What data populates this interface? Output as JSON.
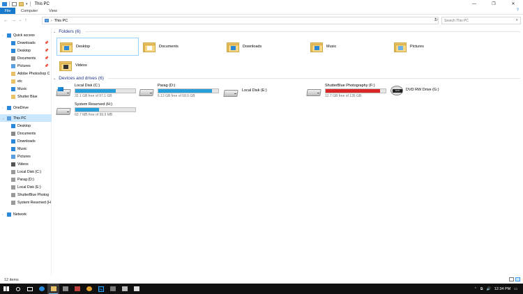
{
  "window": {
    "title": "This PC",
    "buttons": [
      "—",
      "❐",
      "✕"
    ]
  },
  "ribbon": {
    "tabs": [
      "File",
      "Computer",
      "View"
    ],
    "help": "?"
  },
  "nav": {
    "back": "←",
    "forward": "→",
    "recent": "⌄",
    "up": "↑"
  },
  "address": {
    "separator": "›",
    "crumb": "This PC",
    "refresh": "↻"
  },
  "search": {
    "placeholder": "Search This PC",
    "icon_glyph": "⌕"
  },
  "sidebar": {
    "items": [
      {
        "label": "Quick access",
        "icon": "star-icon",
        "color": "#2b88d8",
        "pinned": false,
        "selected": false
      },
      {
        "label": "Downloads",
        "icon": "download-icon",
        "color": "#2b88d8",
        "pinned": true,
        "selected": false
      },
      {
        "label": "Desktop",
        "icon": "desktop-icon",
        "color": "#2b88d8",
        "pinned": true,
        "selected": false
      },
      {
        "label": "Documents",
        "icon": "documents-icon",
        "color": "#8a8a8a",
        "pinned": true,
        "selected": false
      },
      {
        "label": "Pictures",
        "icon": "pictures-icon",
        "color": "#5aa0e0",
        "pinned": true,
        "selected": false
      },
      {
        "label": "Adobe Photoshop C",
        "icon": "folder-icon",
        "color": "#e8c169",
        "pinned": false,
        "selected": false
      },
      {
        "label": "etc",
        "icon": "folder-icon",
        "color": "#e8c169",
        "pinned": false,
        "selected": false
      },
      {
        "label": "Music",
        "icon": "music-icon",
        "color": "#2b88d8",
        "pinned": false,
        "selected": false
      },
      {
        "label": "Shutter Blue",
        "icon": "folder-icon",
        "color": "#e8c169",
        "pinned": false,
        "selected": false
      },
      {
        "label": "OneDrive",
        "icon": "cloud-icon",
        "color": "#2b88d8",
        "pinned": false,
        "selected": false
      },
      {
        "label": "This PC",
        "icon": "computer-icon",
        "color": "#5aa0e0",
        "pinned": false,
        "selected": true
      },
      {
        "label": "Desktop",
        "icon": "desktop-icon",
        "color": "#2b88d8",
        "pinned": false,
        "selected": false
      },
      {
        "label": "Documents",
        "icon": "documents-icon",
        "color": "#8a8a8a",
        "pinned": false,
        "selected": false
      },
      {
        "label": "Downloads",
        "icon": "download-icon",
        "color": "#2b88d8",
        "pinned": false,
        "selected": false
      },
      {
        "label": "Music",
        "icon": "music-icon",
        "color": "#2b88d8",
        "pinned": false,
        "selected": false
      },
      {
        "label": "Pictures",
        "icon": "pictures-icon",
        "color": "#5aa0e0",
        "pinned": false,
        "selected": false
      },
      {
        "label": "Videos",
        "icon": "videos-icon",
        "color": "#555555",
        "pinned": false,
        "selected": false
      },
      {
        "label": "Local Disk (C:)",
        "icon": "drive-icon",
        "color": "#9a9a9a",
        "pinned": false,
        "selected": false
      },
      {
        "label": "Parag (D:)",
        "icon": "drive-icon",
        "color": "#9a9a9a",
        "pinned": false,
        "selected": false
      },
      {
        "label": "Local Disk (E:)",
        "icon": "drive-icon",
        "color": "#9a9a9a",
        "pinned": false,
        "selected": false
      },
      {
        "label": "ShutterBlue Photog",
        "icon": "drive-icon",
        "color": "#9a9a9a",
        "pinned": false,
        "selected": false
      },
      {
        "label": "System Reserved (H",
        "icon": "drive-icon",
        "color": "#9a9a9a",
        "pinned": false,
        "selected": false
      },
      {
        "label": "Network",
        "icon": "network-icon",
        "color": "#2b88d8",
        "pinned": false,
        "selected": false
      }
    ],
    "pin_glyph": "📌"
  },
  "folders": {
    "heading": "Folders (6)",
    "items": [
      {
        "label": "Desktop",
        "emblem": "desktop",
        "selected": true
      },
      {
        "label": "Documents",
        "emblem": "documents",
        "selected": false
      },
      {
        "label": "Downloads",
        "emblem": "downloads",
        "selected": false
      },
      {
        "label": "Music",
        "emblem": "music",
        "selected": false
      },
      {
        "label": "Pictures",
        "emblem": "pictures",
        "selected": false
      },
      {
        "label": "Videos",
        "emblem": "videos",
        "selected": false
      }
    ]
  },
  "drives": {
    "heading": "Devices and drives (6)",
    "items": [
      {
        "label": "Local Disk (C:)",
        "free": "32.1 GB free of 97.1 GB",
        "used_fraction": 0.67,
        "bar_color": "#26a0da",
        "windows": true,
        "type": "disk"
      },
      {
        "label": "Parag (D:)",
        "free": "6.12 GB free of 58.5 GB",
        "used_fraction": 0.9,
        "bar_color": "#26a0da",
        "windows": false,
        "type": "disk"
      },
      {
        "label": "Local Disk (E:)",
        "free": "",
        "used_fraction": null,
        "bar_color": "",
        "windows": false,
        "type": "disk"
      },
      {
        "label": "ShutterBlue Photography (F:)",
        "free": "12.7 GB free of 135 GB",
        "used_fraction": 0.91,
        "bar_color": "#da2626",
        "windows": false,
        "type": "disk"
      },
      {
        "label": "DVD RW Drive (G:)",
        "free": "",
        "used_fraction": null,
        "bar_color": "",
        "windows": false,
        "type": "dvd"
      },
      {
        "label": "System Reserved (H:)",
        "free": "60.7 MB free of 99.9 MB",
        "used_fraction": 0.39,
        "bar_color": "#26a0da",
        "windows": false,
        "type": "disk"
      }
    ],
    "dvd_badge": "DVD"
  },
  "status": {
    "items_count": "12 items"
  },
  "taskbar": {
    "apps": [
      {
        "name": "start-button",
        "icon": "windows-logo-icon"
      },
      {
        "name": "search-button",
        "icon": "search-icon"
      },
      {
        "name": "task-view-button",
        "icon": "task-view-icon"
      },
      {
        "name": "edge-app",
        "icon": "edge-icon"
      },
      {
        "name": "explorer-app",
        "icon": "folder-icon"
      },
      {
        "name": "app-2",
        "icon": "app-icon"
      },
      {
        "name": "app-3",
        "icon": "app-icon"
      },
      {
        "name": "chrome-app",
        "icon": "chrome-icon"
      },
      {
        "name": "photoshop-app",
        "icon": "photoshop-icon"
      },
      {
        "name": "app-6",
        "icon": "app-icon"
      },
      {
        "name": "app-7",
        "icon": "app-icon"
      },
      {
        "name": "app-8",
        "icon": "app-icon"
      }
    ],
    "clock": "12:34 PM",
    "tray_glyphs": {
      "chevron": "⌃",
      "network": "⧉",
      "volume": "🔊",
      "action_center": "▭"
    },
    "ps_glyph": "Ps"
  }
}
